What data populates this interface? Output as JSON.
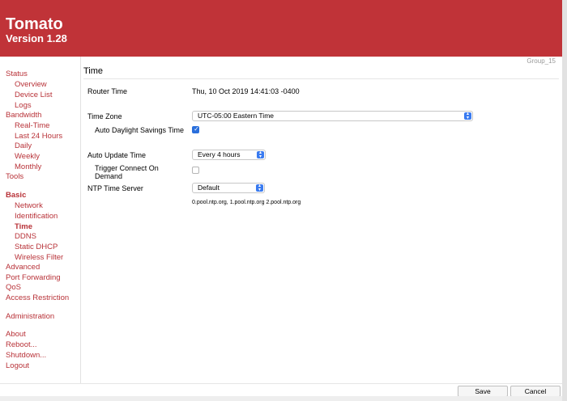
{
  "header": {
    "title": "Tomato",
    "version": "Version 1.28"
  },
  "group_label": "Group_15",
  "sidebar": {
    "status": "Status",
    "overview": "Overview",
    "device_list": "Device List",
    "logs": "Logs",
    "bandwidth": "Bandwidth",
    "real_time": "Real-Time",
    "last_24": "Last 24 Hours",
    "daily": "Daily",
    "weekly": "Weekly",
    "monthly": "Monthly",
    "tools": "Tools",
    "basic": "Basic",
    "network": "Network",
    "identification": "Identification",
    "time": "Time",
    "ddns": "DDNS",
    "static_dhcp": "Static DHCP",
    "wireless_filter": "Wireless Filter",
    "advanced": "Advanced",
    "port_forwarding": "Port Forwarding",
    "qos": "QoS",
    "access_restriction": "Access Restriction",
    "administration": "Administration",
    "about": "About",
    "reboot": "Reboot...",
    "shutdown": "Shutdown...",
    "logout": "Logout"
  },
  "main": {
    "section_title": "Time",
    "router_time_label": "Router Time",
    "router_time_value": "Thu, 10 Oct 2019 14:41:03 -0400",
    "time_zone_label": "Time Zone",
    "time_zone_value": "UTC-05:00 Eastern Time",
    "dst_label": "Auto Daylight Savings Time",
    "dst_checked": true,
    "auto_update_label": "Auto Update Time",
    "auto_update_value": "Every 4 hours",
    "trigger_label_line1": "Trigger Connect On",
    "trigger_label_line2": "Demand",
    "trigger_checked": false,
    "ntp_label": "NTP Time Server",
    "ntp_value": "Default",
    "ntp_servers": "0.pool.ntp.org, 1.pool.ntp.org 2.pool.ntp.org"
  },
  "footer": {
    "save": "Save",
    "cancel": "Cancel"
  },
  "colors": {
    "brand": "#c03338",
    "link": "#b83238",
    "checkbox": "#2a6fdc"
  }
}
